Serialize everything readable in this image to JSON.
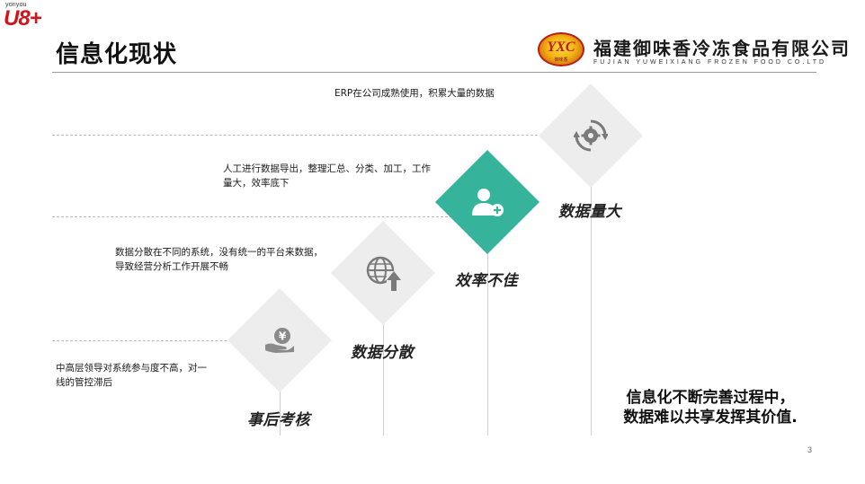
{
  "brand": {
    "small": "yonyou",
    "big": "U8+"
  },
  "title": "信息化现状",
  "company": {
    "emblem_text": "YXC",
    "emblem_sub": "御味香",
    "name_cn": "福建御味香冷冻食品有限公司",
    "name_en": "FUJIAN YUWEIXIANG FROZEN FOOD CO.LTD"
  },
  "steps": [
    {
      "label": "事后考核",
      "desc_lines": [
        "中高层领导对系统参与度不高，对一",
        "线的管控滞后"
      ],
      "icon": "yen-hand-icon",
      "color": "#ededed"
    },
    {
      "label": "数据分散",
      "desc_lines": [
        "数据分散在不同的系统，没有统一的平台来数据，",
        "导致经营分析工作开展不畅"
      ],
      "icon": "globe-upload-icon",
      "color": "#ededed"
    },
    {
      "label": "效率不佳",
      "desc_lines": [
        "人工进行数据导出，整理汇总、分类、加工，工作",
        "量大，效率底下"
      ],
      "icon": "user-add-icon",
      "color": "#35b39b"
    },
    {
      "label": "数据量大",
      "desc_lines": [
        "ERP在公司成熟使用，积累大量的数据"
      ],
      "icon": "gear-refresh-icon",
      "color": "#ededed"
    }
  ],
  "conclusion": {
    "line1": "信息化不断完善过程中，",
    "line2": "数据难以共享发挥其价值."
  },
  "page_number": "3"
}
